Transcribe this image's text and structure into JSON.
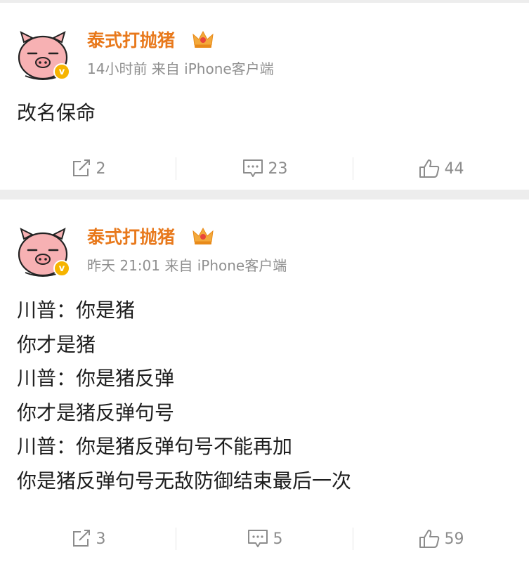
{
  "posts": [
    {
      "username": "泰式打抛猪",
      "meta": "14小时前 来自 iPhone客户端",
      "lines": [
        "改名保命"
      ],
      "repost_count": "2",
      "comment_count": "23",
      "like_count": "44"
    },
    {
      "username": "泰式打抛猪",
      "meta": "昨天 21:01 来自 iPhone客户端",
      "lines": [
        "川普：你是猪",
        "你才是猪",
        "川普：你是猪反弹",
        "你才是猪反弹句号",
        "川普：你是猪反弹句号不能再加",
        "你是猪反弹句号无敌防御结束最后一次"
      ],
      "repost_count": "3",
      "comment_count": "5",
      "like_count": "59"
    }
  ],
  "colors": {
    "username": "#e8791c",
    "verified_badge": "#f6b400",
    "avatar_skin": "#f7b1b3",
    "meta_text": "#8f8f8f"
  }
}
